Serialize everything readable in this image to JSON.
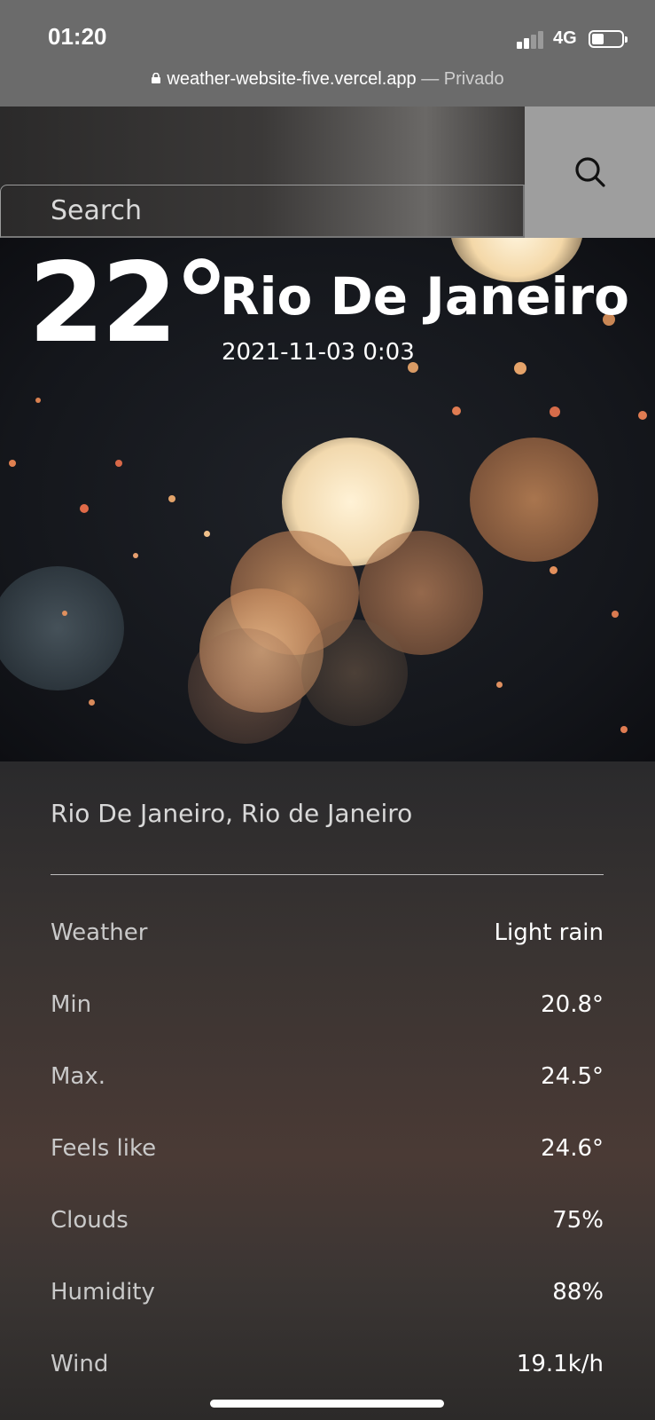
{
  "status_bar": {
    "time": "01:20",
    "network": "4G"
  },
  "url_bar": {
    "domain": "weather-website-five.vercel.app",
    "suffix": "— Privado"
  },
  "search": {
    "placeholder": "Search"
  },
  "hero": {
    "temperature": "22°",
    "city": "Rio De Janeiro",
    "datetime": "2021-11-03 0:03"
  },
  "details": {
    "location": "Rio De Janeiro, Rio de Janeiro",
    "rows": [
      {
        "label": "Weather",
        "value": "Light rain"
      },
      {
        "label": "Min",
        "value": "20.8°"
      },
      {
        "label": "Max.",
        "value": "24.5°"
      },
      {
        "label": "Feels like",
        "value": "24.6°"
      },
      {
        "label": "Clouds",
        "value": "75%"
      },
      {
        "label": "Humidity",
        "value": "88%"
      },
      {
        "label": "Wind",
        "value": "19.1k/h"
      }
    ]
  },
  "colors": {
    "browser_chrome": "#6b6b6b",
    "search_button": "#9e9e9e",
    "label_text": "#c9c9c9",
    "value_text": "#ffffff"
  }
}
